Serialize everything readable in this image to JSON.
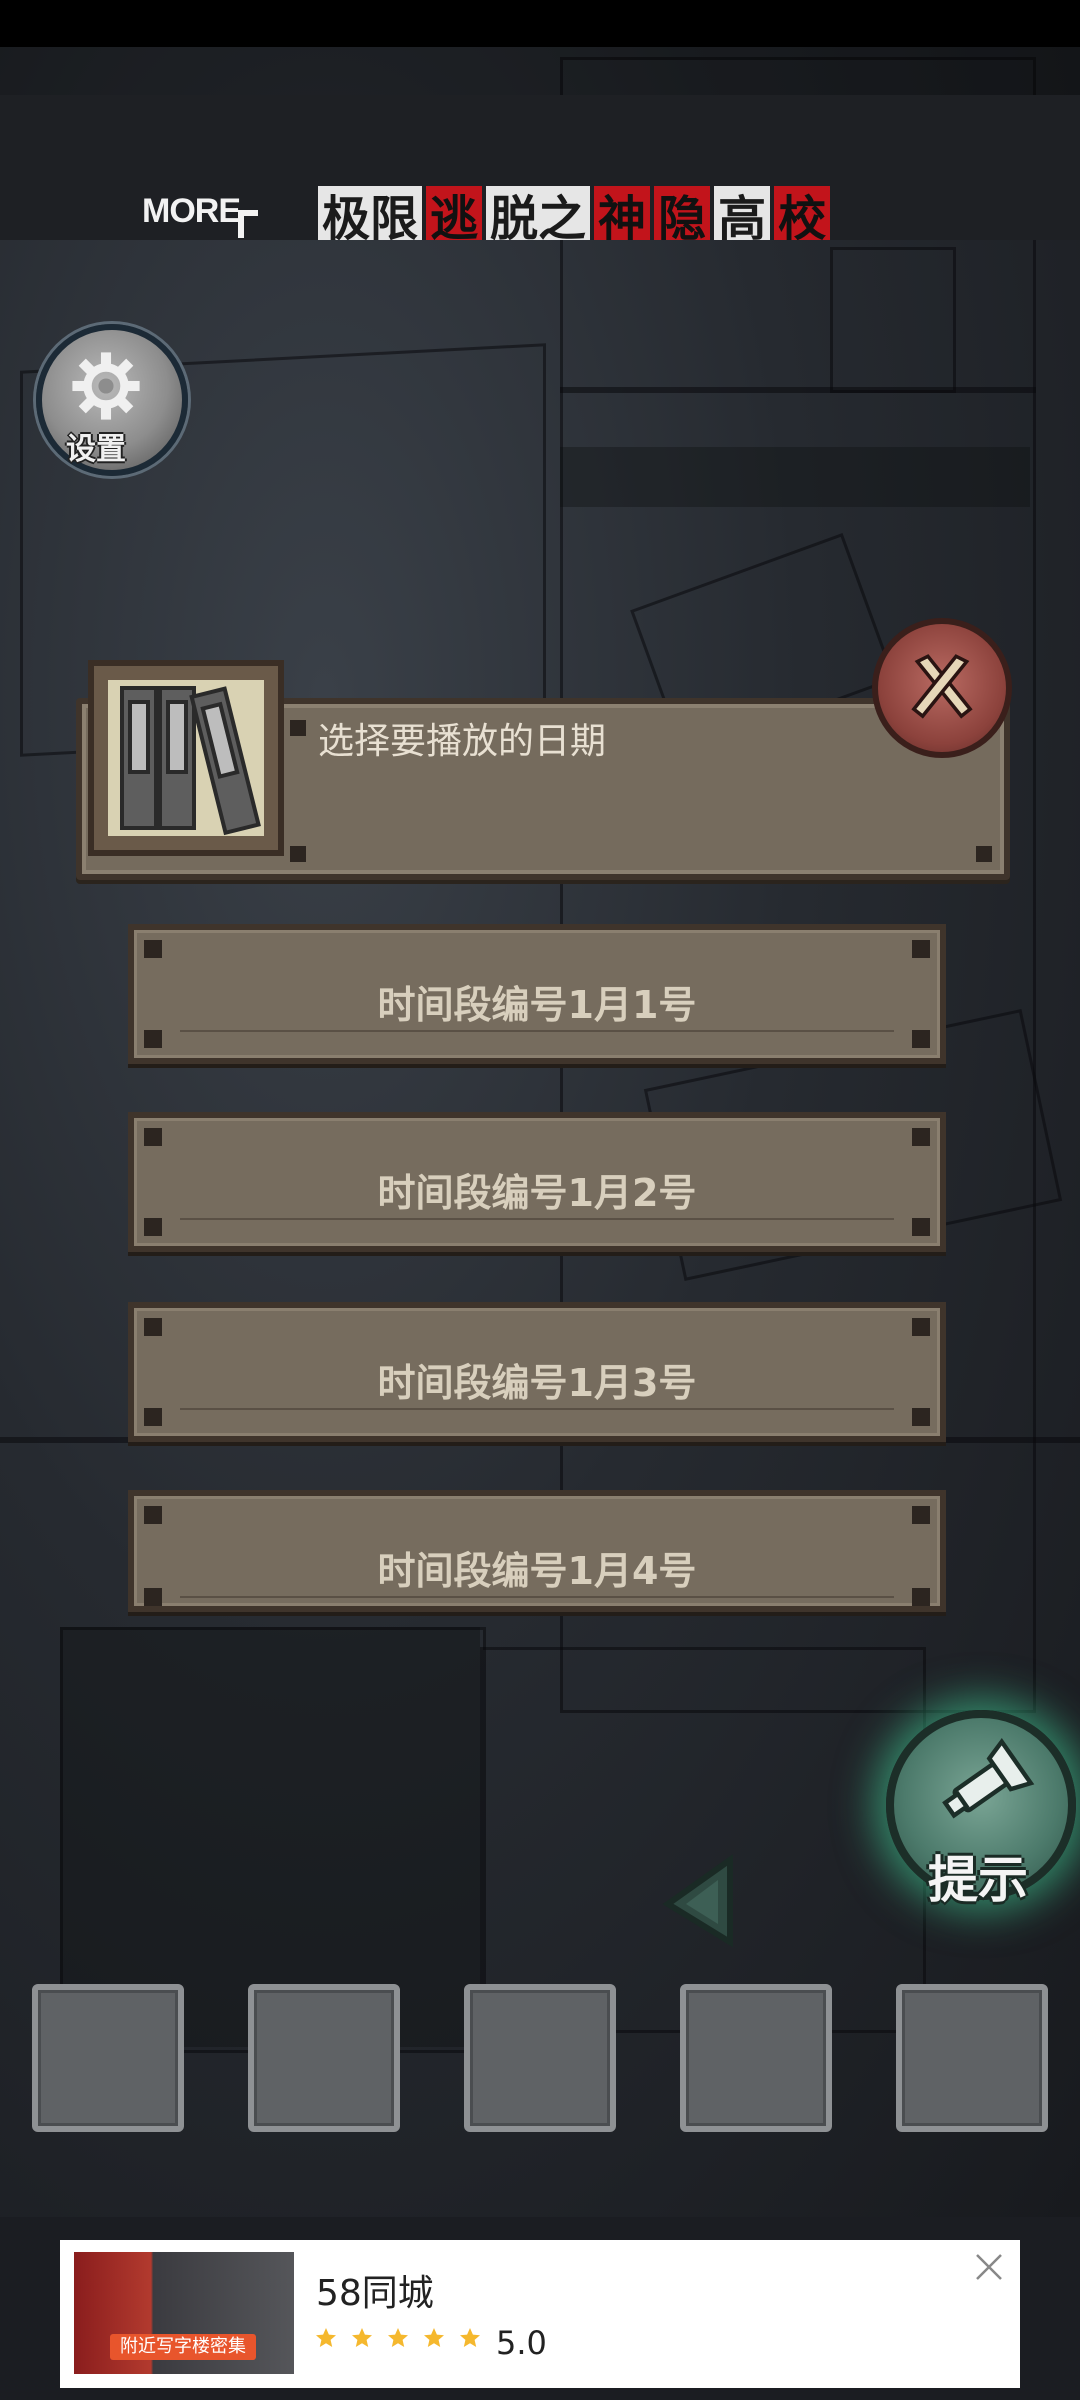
{
  "top_bar": {
    "more_label": "MORE",
    "game_title": [
      {
        "text": "极限",
        "style": "white"
      },
      {
        "text": "逃",
        "style": "red"
      },
      {
        "text": "脱之",
        "style": "white"
      },
      {
        "text": "神",
        "style": "red"
      },
      {
        "text": "隐",
        "style": "red"
      },
      {
        "text": "高",
        "style": "white"
      },
      {
        "text": "校",
        "style": "red"
      }
    ]
  },
  "settings": {
    "label": "设置",
    "icon": "gear-icon"
  },
  "dialog": {
    "prompt": "选择要播放的日期",
    "icon": "binders-icon",
    "close_icon": "crossed-tools-icon",
    "options": [
      {
        "label": "时间段编号1月1号"
      },
      {
        "label": "时间段编号1月2号"
      },
      {
        "label": "时间段编号1月3号"
      },
      {
        "label": "时间段编号1月4号"
      }
    ]
  },
  "hint": {
    "label": "提示",
    "icon": "flashlight-icon",
    "glow_color": "#46dca0"
  },
  "inventory": {
    "slot_count": 5
  },
  "ad": {
    "title": "58同城",
    "thumb_caption": "附近写字楼密集",
    "rating": "5.0",
    "stars": 5,
    "star_color": "#f5b82e"
  },
  "colors": {
    "panel": "#766c5e",
    "panel_border": "#3f342b",
    "title_red": "#c2141b"
  }
}
